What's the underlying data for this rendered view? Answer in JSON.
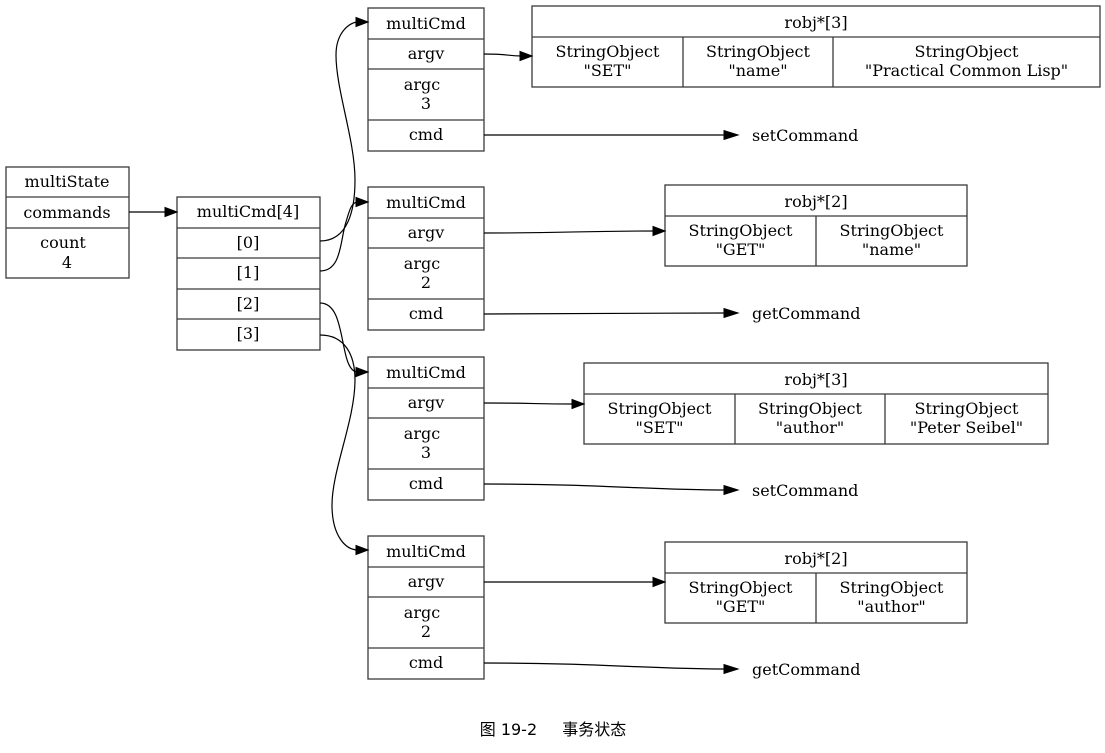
{
  "multi_state": {
    "title": "multiState",
    "fields": [
      "commands",
      "count\n4"
    ]
  },
  "cmd_array": {
    "title": "multiCmd[4]",
    "slots": [
      "[0]",
      "[1]",
      "[2]",
      "[3]"
    ]
  },
  "multi_cmds": [
    {
      "title": "multiCmd",
      "argv": "argv",
      "argc_label": "argc",
      "argc": "3",
      "cmd": "cmd",
      "command": "setCommand",
      "robj": {
        "title": "robj*[3]",
        "items": [
          {
            "type": "StringObject",
            "value": "\"SET\""
          },
          {
            "type": "StringObject",
            "value": "\"name\""
          },
          {
            "type": "StringObject",
            "value": "\"Practical Common Lisp\""
          }
        ]
      }
    },
    {
      "title": "multiCmd",
      "argv": "argv",
      "argc_label": "argc",
      "argc": "2",
      "cmd": "cmd",
      "command": "getCommand",
      "robj": {
        "title": "robj*[2]",
        "items": [
          {
            "type": "StringObject",
            "value": "\"GET\""
          },
          {
            "type": "StringObject",
            "value": "\"name\""
          }
        ]
      }
    },
    {
      "title": "multiCmd",
      "argv": "argv",
      "argc_label": "argc",
      "argc": "3",
      "cmd": "cmd",
      "command": "setCommand",
      "robj": {
        "title": "robj*[3]",
        "items": [
          {
            "type": "StringObject",
            "value": "\"SET\""
          },
          {
            "type": "StringObject",
            "value": "\"author\""
          },
          {
            "type": "StringObject",
            "value": "\"Peter Seibel\""
          }
        ]
      }
    },
    {
      "title": "multiCmd",
      "argv": "argv",
      "argc_label": "argc",
      "argc": "2",
      "cmd": "cmd",
      "command": "getCommand",
      "robj": {
        "title": "robj*[2]",
        "items": [
          {
            "type": "StringObject",
            "value": "\"GET\""
          },
          {
            "type": "StringObject",
            "value": "\"author\""
          }
        ]
      }
    }
  ],
  "caption": {
    "figure": "图 19-2",
    "title": "事务状态"
  }
}
